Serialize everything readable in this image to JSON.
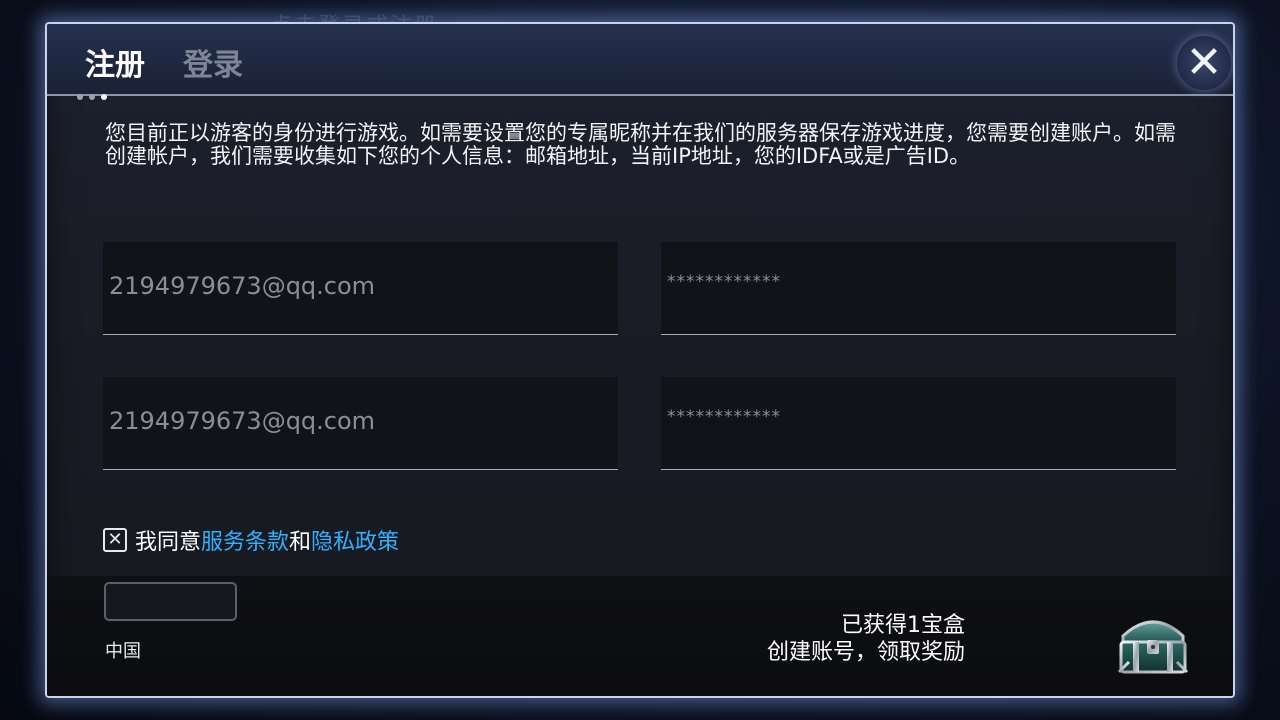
{
  "background": {
    "ghost_title": "点击登录或注册"
  },
  "header": {
    "tab_register": "注册",
    "tab_login": "登录",
    "close_glyph": "✕"
  },
  "notice": "您目前正以游客的身份进行游戏。如需要设置您的专属昵称并在我们的服务器保存游戏进度，您需要创建账户。如需创建帐户，我们需要收集如下您的个人信息：邮箱地址，当前IP地址，您的IDFA或是广告ID。",
  "form": {
    "email_value": "2194979673@qq.com",
    "email_confirm_value": "2194979673@qq.com",
    "password_value": "************",
    "password_confirm_value": "************"
  },
  "agreement": {
    "prefix": "我同意",
    "terms_link": "服务条款",
    "conjunction": "和",
    "privacy_link": "隐私政策",
    "checked_glyph": "✕"
  },
  "footer": {
    "country_label": "中国",
    "reward_line1": "已获得1宝盒",
    "reward_line2": "创建账号，领取奖励",
    "chest_icon": "treasure-chest-icon"
  },
  "colors": {
    "link": "#2fb1ff",
    "dialog_border": "#c9d3ea",
    "active_tab": "#ffffff",
    "inactive_tab": "#7d8597"
  }
}
